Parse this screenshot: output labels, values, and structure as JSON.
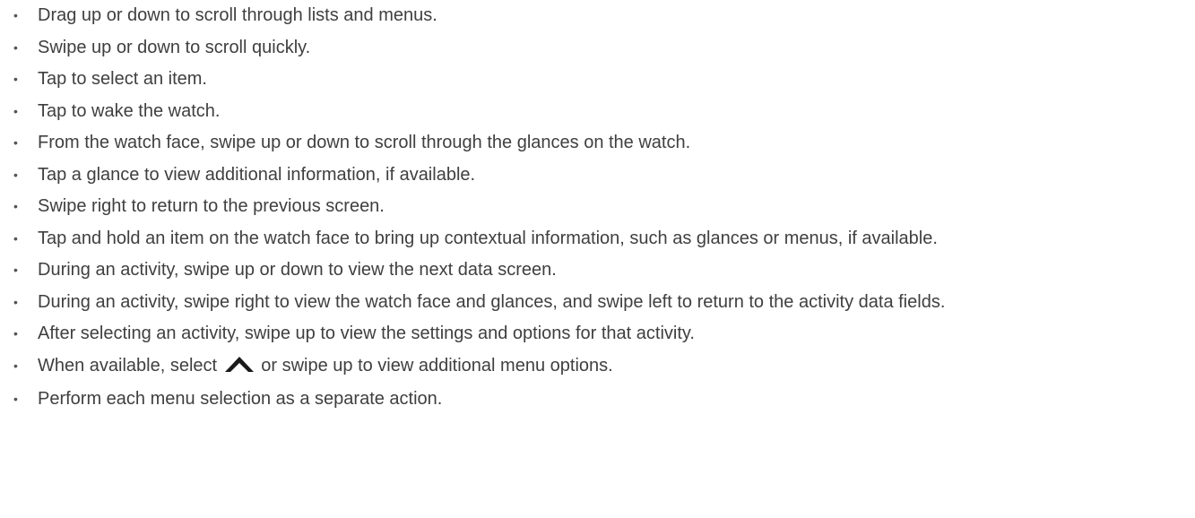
{
  "items": [
    {
      "text": "Drag up or down to scroll through lists and menus."
    },
    {
      "text": "Swipe up or down to scroll quickly."
    },
    {
      "text": "Tap to select an item."
    },
    {
      "text": "Tap to wake the watch."
    },
    {
      "text": "From the watch face, swipe up or down to scroll through the glances on the watch."
    },
    {
      "text": "Tap a glance to view additional information, if available."
    },
    {
      "text": "Swipe right to return to the previous screen."
    },
    {
      "text": "Tap and hold an item on the watch face to bring up contextual information, such as glances or menus, if available."
    },
    {
      "text": "During an activity, swipe up or down to view the next data screen."
    },
    {
      "text": "During an activity, swipe right to view the watch face and glances, and swipe left to return to the activity data fields."
    },
    {
      "text": "After selecting an activity, swipe up to view the settings and options for that activity."
    },
    {
      "before": "When available, select",
      "icon": "chevron-up-icon",
      "after": "or swipe up to view additional menu options."
    },
    {
      "text": "Perform each menu selection as a separate action."
    }
  ],
  "bullet_char": "•",
  "colors": {
    "text": "#3f3f3f",
    "icon": "#1a1a1a"
  }
}
